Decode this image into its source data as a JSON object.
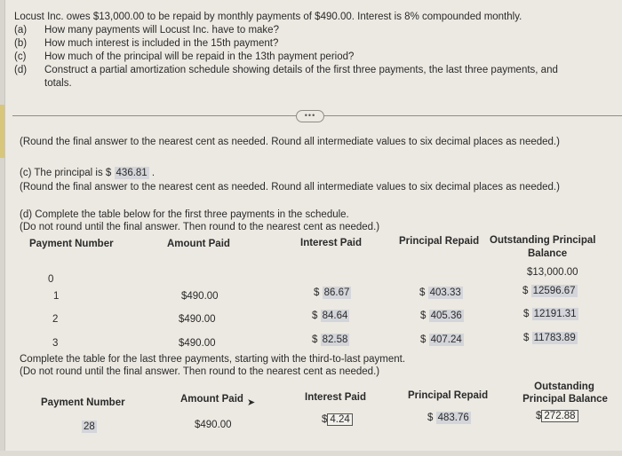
{
  "problem": {
    "intro": "Locust Inc. owes $13,000.00 to be repaid by monthly payments of $490.00. Interest is 8% compounded monthly.",
    "parts": [
      {
        "label": "(a)",
        "text": "How many payments will Locust Inc. have to make?"
      },
      {
        "label": "(b)",
        "text": "How much interest is included in the 15th payment?"
      },
      {
        "label": "(c)",
        "text": "How much of the principal will be repaid in the 13th payment period?"
      },
      {
        "label": "(d)",
        "text": "Construct a partial amortization schedule showing details of the first three payments, the last three payments, and"
      },
      {
        "label": "",
        "text": "totals."
      }
    ]
  },
  "more_button": "•••",
  "round_note_1": "(Round the final answer to the nearest cent as needed. Round all intermediate values to six decimal places as needed.)",
  "part_c": {
    "prefix": "(c) The principal is $",
    "value": "436.81",
    "suffix": ".",
    "note": "(Round the final answer to the nearest cent as needed. Round all intermediate values to six decimal places as needed.)"
  },
  "part_d_first": {
    "instruction": "(d) Complete the table below for the first three payments in the schedule.",
    "note": "(Do not round until the final answer. Then round to the nearest cent as needed.)",
    "headers": {
      "payment_number": "Payment Number",
      "amount_paid": "Amount Paid",
      "interest_paid": "Interest Paid",
      "principal_repaid": "Principal Repaid",
      "outstanding_line1": "Outstanding Principal",
      "outstanding_line2": "Balance"
    },
    "rows": [
      {
        "number": "0",
        "amount": "",
        "interest": "",
        "principal": "",
        "balance": "$13,000.00"
      },
      {
        "number": "1",
        "amount": "$490.00",
        "interest": "86.67",
        "principal": "403.33",
        "balance": "12596.67"
      },
      {
        "number": "2",
        "amount": "$490.00",
        "interest": "84.64",
        "principal": "405.36",
        "balance": "12191.31"
      },
      {
        "number": "3",
        "amount": "$490.00",
        "interest": "82.58",
        "principal": "407.24",
        "balance": "11783.89"
      }
    ]
  },
  "part_d_last": {
    "instruction": "Complete the table for the last three payments, starting with the third-to-last payment.",
    "note": "(Do not round until the final answer. Then round to the nearest cent as needed.)",
    "headers": {
      "payment_number": "Payment Number",
      "amount_paid": "Amount Paid",
      "interest_paid": "Interest Paid",
      "principal_repaid": "Principal Repaid",
      "outstanding_line1": "Outstanding",
      "outstanding_line2": "Principal Balance"
    },
    "rows": [
      {
        "number": "28",
        "amount": "$490.00",
        "interest": "4.24",
        "principal": "483.76",
        "balance": "272.88"
      }
    ]
  },
  "currency_symbol": "$"
}
